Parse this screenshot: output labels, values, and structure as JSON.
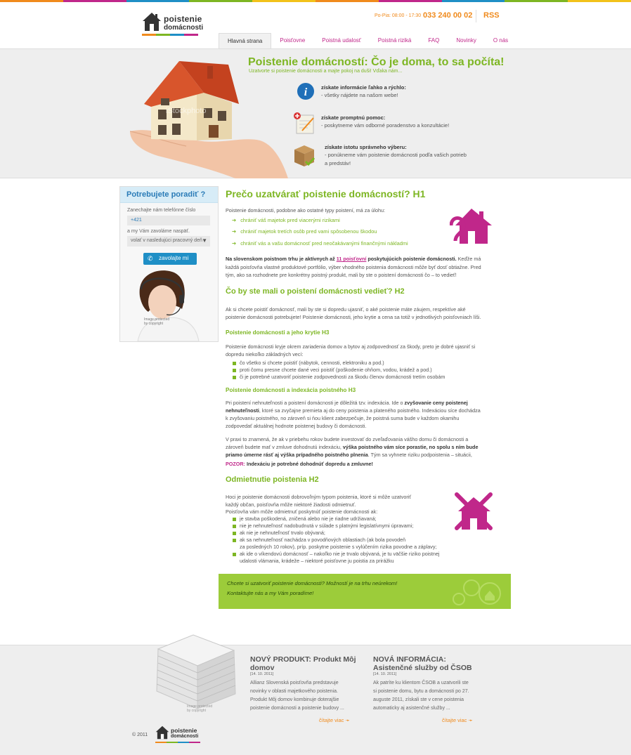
{
  "colors": {
    "green": "#7db623",
    "pink": "#c0278a",
    "orange": "#f08a1c",
    "blue": "#1f8fc6",
    "stripe": [
      "#f08a1c",
      "#c0278a",
      "#1f8fc6",
      "#7db623",
      "#f2c21a",
      "#f08a1c",
      "#c0278a",
      "#1f8fc6",
      "#7db623",
      "#f2c21a"
    ]
  },
  "header": {
    "logo_line1": "poistenie",
    "logo_line2": "domácnosti",
    "hours": "Po-Pia: 08:00 - 17:30",
    "phone": "033 240 00 02",
    "rss": "RSS"
  },
  "nav": [
    {
      "label": "Hlavná strana",
      "active": true
    },
    {
      "label": "Poisťovne"
    },
    {
      "label": "Poistná udalosť"
    },
    {
      "label": "Poistná riziká"
    },
    {
      "label": "FAQ"
    },
    {
      "label": "Novinky"
    },
    {
      "label": "O nás"
    }
  ],
  "hero": {
    "title": "Poistenie domácností: Čo je doma, to sa počíta!",
    "subtitle": "Uzatvorte si poistenie domácnosti a majte pokoj na duši! Vďaka nám...",
    "features": [
      {
        "icon": "info-icon",
        "title": "získate informácie ľahko a rýchlo:",
        "lines": [
          "- všetky nájdete na našom webe!"
        ]
      },
      {
        "icon": "notepad-icon",
        "title": "získate promptnú pomoc:",
        "lines": [
          "- poskytneme vám odborné poradenstvo  a konzultácie!"
        ]
      },
      {
        "icon": "box-icon",
        "title": "získate istotu správneho výberu:",
        "lines": [
          "- ponúkneme vám poistenie domácnosti podľa vašich potrieb",
          "a predstáv!"
        ]
      }
    ],
    "watermark": "iStockphoto"
  },
  "sidebar": {
    "title": "Potrebujete poradiť ?",
    "text1": "Zanechajte nám telefónne číslo",
    "phone_value": "+421",
    "text2": "a my Vám zavoláme naspäť.",
    "select_value": "volať v nasledujúci pracovný deň",
    "button": "zavolajte mi",
    "photo_note": "Image protected by copyright"
  },
  "content": {
    "h1": "Prečo uzatvárať poistenie domácností? H1",
    "intro": "Poistenie domácnosti, podobne ako ostatné typy poistení, má za úlohu:",
    "bullets": [
      "chrániť váš majetok pred viacerými rizikami",
      "chrániť majetok tretích osôb pred vami spôsobenou škodou",
      "chrániť vás a vašu domácnosť pred neočakávanými finančnými nákladmi"
    ],
    "p1_bold": "Na slovenskom poistnom trhu je aktívnych až",
    "p1_link": "11 poisťovní",
    "p1_bold2": "poskytujúcich poistenie domácnosti.",
    "p1_rest": "Keďže má",
    "p1_l2": "každá poisťovňa vlastné produktové portfólio, výber vhodného poistenia domácnosti môže byť dosť obtiažne. Pred",
    "p1_l3": "tým, ako sa rozhodnete pre konkrétny poistný produkt, mali by ste o poistení domácnosti čo – to vedieť!",
    "h2_1": "Čo by ste mali o poistení domácnosti vedieť? H2",
    "p2_l1": "Ak si chcete poistiť domácnosť, mali by ste si dopredu ujasniť, o aké poistenie máte záujem, respektíve aké",
    "p2_l2": "poistenie domácnosti potrebujete! Poistenie domácnosti, jeho krytie a cena sa totiž v jednotlivých poisťovniach líši.",
    "h3_1": "Poistenie domácnosti a jeho krytie H3",
    "p3_l1": "Poistenie domácnosti kryje okrem zariadenia domov a bytov aj zodpovednosť za škody, preto je dobré ujasniť si",
    "p3_l2": "dopredu niekoľko základných vecí:",
    "sq1": [
      "čo všetko si chcete poistiť (nábytok, cennosti, elektroniku a pod.)",
      "proti čomu presne chcete dané veci poistiť (poškodenie ohňom, vodou, krádež a pod.)",
      "či je potrebné uzatvoriť poistenie zodpovednosti za škodu členov domácnosti tretím osobám"
    ],
    "h3_2": "Poistenie domácnosti a indexácia poistného H3",
    "p4_l1a": "Pri poistení nehnuteľnosti a poistení domácnosti je dôležitá tzv. indexácia. Ide o",
    "p4_l1b": "zvyšovanie ceny poistenej",
    "p4_l2a": "nehnuteľnosti",
    "p4_l2b": ", ktoré sa zvyčajne premieta aj do ceny poistenia a plateného poistného. Indexáciou síce dochádza",
    "p4_l3": "k zvyšovaniu poistného, no zároveň si ňou klient zabezpečuje, že poistná suma bude v každom okamihu",
    "p4_l4": "zodpovedať aktuálnej hodnote poistenej budovy či domácnosti.",
    "p5_l1": "V praxi to znamená, že ak v priebehu rokov budete investovať do zveľaďovania vášho domu či domácnosti a",
    "p5_l2a": "zároveň budete mať v zmluve dohodnutú indexáciu,",
    "p5_l2b": "výška poistného vám síce porastie, no spolu s ním bude",
    "p5_l3a": "priamo úmerne rásť aj výška prípadného poistného plnenia",
    "p5_l3b": ". Tým sa vyhnete riziku podpoistenia – situácii,",
    "pozor_label": "POZOR:",
    "pozor_text": "Indexáciu je potrebné dohodnúť dopredu a zmluvne!",
    "h2_2": "Odmietnutie poistenia H2",
    "p6_l1": "Hoci je poistenie domácnosti dobrovoľným typom poistenia, ktoré si môže uzatvoriť",
    "p6_l2": "každý občan, poisťovňa môže niektoré žiadosti odmietnuť.",
    "p6_l3": "Poisťovňa vám môže odmietnuť poskytnúť poistenie domácnosti ak:",
    "sq2": [
      "je stavba poškodená, zničená alebo nie je riadne udržiavaná;",
      "nie je nehnuteľnosť nadobudnutá v súlade s platnými legislatívnymi úpravami;",
      "ak nie je nehnuteľnosť trvalo obývaná;",
      "ak sa nehnuteľnosť nachádza v povodňových oblastiach (ak bola povodeň",
      "za posledných 10 rokov), príp. poskytne poistenie s vylúčením rizika povodne a záplavy;",
      "ak ide o víkendovú domácnosť – nakoľko nie je trvalo obývaná, je tu väčšie riziko poistnej",
      "udalosti vlámania, krádeže – niektoré poisťovne ju poistia za prirážku"
    ],
    "cta_l1": "Chcete si uzatvoriť poistenie domácnosti? Možností je na trhu neúrekom!",
    "cta_l2": "Kontaktujte nás a my Vám poradíme!"
  },
  "footer": {
    "news": [
      {
        "title_l1": "NOVÝ PRODUKT: Produkt Môj",
        "title_l2": "domov",
        "date": "[14. 10. 2011]",
        "lines": [
          "Allianz Slovenská poisťovňa predstavuje",
          "novinky v oblasti majetkového poistenia.",
          "Produkt Môj domov kombinuje doterajšie",
          "poistenie domácnosti a poistenie budovy ..."
        ],
        "more": "čítajte viac"
      },
      {
        "title_l1": "NOVÁ INFORMÁCIA:",
        "title_l2": "Asistenčné služby od ČSOB",
        "date": "[14. 10. 2011]",
        "lines": [
          "Ak patríte ku klientom ČSOB a uzatvorili ste",
          "si poistenie domu, bytu a domácnosti po 27.",
          "auguste 2011, získali ste v cene poistenia",
          "automaticky aj asistenčné služby ..."
        ],
        "more": "čítajte viac"
      }
    ],
    "copyright": "© 2011",
    "logo_line1": "poistenie",
    "logo_line2": "domácnosti",
    "newspaper_note": "Image protected by copyright"
  }
}
